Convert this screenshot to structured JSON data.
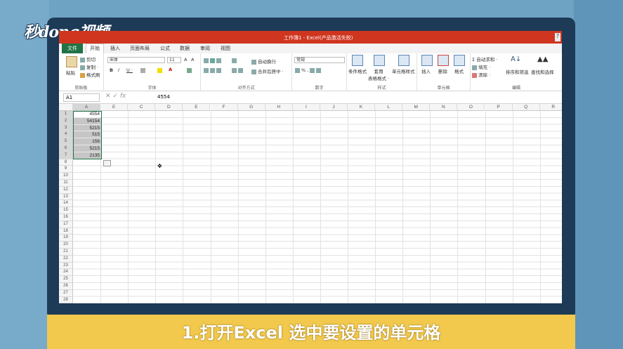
{
  "watermark": "秒dong视频",
  "caption": "1.打开Excel  选中要设置的单元格",
  "window": {
    "title": "工作簿1 -   Excel(产品激活失败)",
    "help": "?"
  },
  "tabs": [
    "文件",
    "开始",
    "插入",
    "页面布局",
    "公式",
    "数据",
    "审阅",
    "视图"
  ],
  "ribbon": {
    "clipboard": {
      "paste": "粘贴",
      "cut": "剪切",
      "copy": "复制 ·",
      "format_painter": "格式刷",
      "label": "剪贴板"
    },
    "font": {
      "name": "宋体",
      "size": "11",
      "bold": "B",
      "italic": "I",
      "underline": "U ·",
      "label": "字体"
    },
    "alignment": {
      "wrap": "自动换行",
      "merge": "合并后居中 ·",
      "label": "对齐方式"
    },
    "number": {
      "format": "常规",
      "label": "数字"
    },
    "styles": {
      "conditional": "条件格式",
      "table": "套用\n表格格式 ·",
      "cell_styles": "单元格样式",
      "label": "样式"
    },
    "cells": {
      "insert": "插入",
      "delete": "删除",
      "format": "格式",
      "label": "单元格"
    },
    "editing": {
      "autosum": "自动求和 ·",
      "fill": "填充 ·",
      "clear": "清除 ·",
      "sort": "排序和筛选",
      "find": "查找和选择",
      "label": "编辑"
    }
  },
  "formula_bar": {
    "name_box": "A1",
    "fx": "fx",
    "value": "4554"
  },
  "columns": [
    "A",
    "E",
    "C",
    "D",
    "E",
    "F",
    "G",
    "H",
    "I",
    "J",
    "K",
    "L",
    "M",
    "N",
    "O",
    "P",
    "Q",
    "R"
  ],
  "rows": [
    "1",
    "2",
    "3",
    "4",
    "5",
    "6",
    "7",
    "8",
    "9",
    "10",
    "11",
    "12",
    "13",
    "14",
    "15",
    "16",
    "17",
    "18",
    "19",
    "20",
    "21",
    "22",
    "23",
    "24",
    "25",
    "26",
    "27",
    "28"
  ],
  "cells_a": [
    "4554",
    "54154",
    "5215",
    "515",
    "156",
    "5215",
    "2135"
  ]
}
